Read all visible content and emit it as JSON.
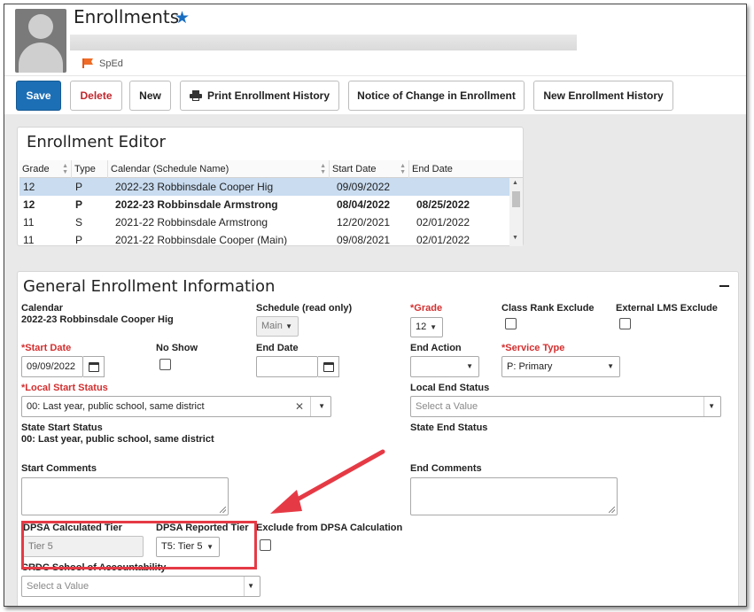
{
  "header": {
    "title": "Enrollments",
    "flag_label": "SpEd"
  },
  "toolbar": {
    "save": "Save",
    "delete": "Delete",
    "new": "New",
    "print_history": "Print Enrollment History",
    "notice_change": "Notice of Change in Enrollment",
    "new_history": "New Enrollment History"
  },
  "editor": {
    "title": "Enrollment Editor",
    "columns": [
      "Grade",
      "Type",
      "Calendar (Schedule Name)",
      "Start Date",
      "End Date"
    ],
    "rows": [
      {
        "grade": "12",
        "type": "P",
        "calendar": "2022-23 Robbinsdale Cooper Hig",
        "start": "09/09/2022",
        "end": ""
      },
      {
        "grade": "12",
        "type": "P",
        "calendar": "2022-23 Robbinsdale Armstrong",
        "start": "08/04/2022",
        "end": "08/25/2022"
      },
      {
        "grade": "11",
        "type": "S",
        "calendar": "2021-22 Robbinsdale Armstrong",
        "start": "12/20/2021",
        "end": "02/01/2022"
      },
      {
        "grade": "11",
        "type": "P",
        "calendar": "2021-22 Robbinsdale Cooper (Main)",
        "start": "09/08/2021",
        "end": "02/01/2022"
      }
    ]
  },
  "general": {
    "title": "General Enrollment Information",
    "calendar_label": "Calendar",
    "calendar_value": "2022-23 Robbinsdale Cooper Hig",
    "schedule_label": "Schedule (read only)",
    "schedule_value": "Main",
    "grade_label": "*Grade",
    "grade_value": "12",
    "class_rank_label": "Class Rank Exclude",
    "external_lms_label": "External LMS Exclude",
    "start_date_label": "*Start Date",
    "start_date_value": "09/09/2022",
    "no_show_label": "No Show",
    "end_date_label": "End Date",
    "end_action_label": "End Action",
    "service_type_label": "*Service Type",
    "service_type_value": "P: Primary",
    "local_start_label": "*Local Start Status",
    "local_start_value": "00: Last year, public school, same district",
    "local_end_label": "Local End Status",
    "local_end_placeholder": "Select a Value",
    "state_start_label": "State Start Status",
    "state_start_value": "00: Last year, public school, same district",
    "state_end_label": "State End Status",
    "start_comments_label": "Start Comments",
    "end_comments_label": "End Comments",
    "dpsa_calc_label": "DPSA Calculated Tier",
    "dpsa_calc_value": "Tier 5",
    "dpsa_reported_label": "DPSA Reported Tier",
    "dpsa_reported_value": "T5: Tier 5",
    "exclude_dpsa_label": "Exclude from DPSA Calculation",
    "crdc_label": "CRDC School of Accountability",
    "crdc_placeholder": "Select a Value"
  },
  "colors": {
    "primary": "#1d6fb5",
    "required": "#d32f2f",
    "highlight": "#e53a45",
    "selected_row": "#c9dcf0"
  },
  "icons": [
    "user-avatar-icon",
    "star-icon",
    "flag-icon",
    "printer-icon",
    "calendar-icon",
    "collapse-icon",
    "clear-icon",
    "chevron-down-icon"
  ]
}
